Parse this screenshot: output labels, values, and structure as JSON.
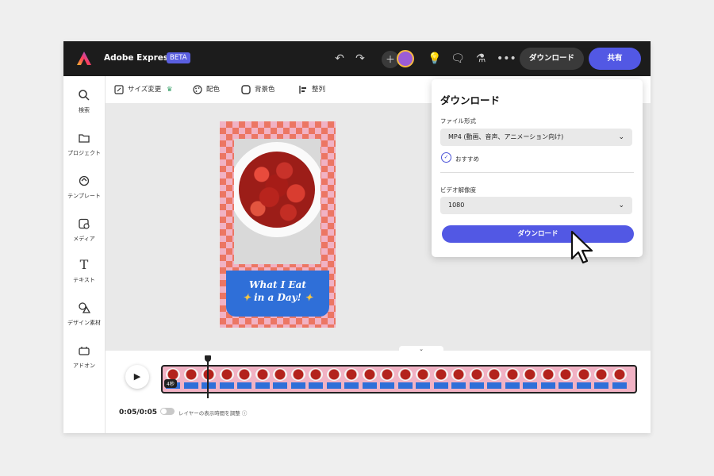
{
  "app": {
    "title": "Adobe Express",
    "beta": "BETA"
  },
  "topbar": {
    "download_label": "ダウンロード",
    "share_label": "共有",
    "icons": [
      "undo-icon",
      "redo-icon",
      "add-user-icon",
      "lightbulb-icon",
      "comment-icon",
      "flask-icon",
      "more-icon"
    ]
  },
  "sidebar": {
    "items": [
      {
        "label": "検索",
        "icon": "search-icon"
      },
      {
        "label": "プロジェクト",
        "icon": "folder-icon"
      },
      {
        "label": "テンプレート",
        "icon": "template-icon"
      },
      {
        "label": "メディア",
        "icon": "media-icon"
      },
      {
        "label": "テキスト",
        "icon": "text-icon"
      },
      {
        "label": "デザイン素材",
        "icon": "shapes-icon"
      },
      {
        "label": "アドオン",
        "icon": "addon-icon"
      }
    ]
  },
  "toolbar": {
    "resize": "サイズ変更",
    "colors": "配色",
    "background": "背景色",
    "align": "整列"
  },
  "design": {
    "line1": "What I Eat",
    "line2": "in a Day!"
  },
  "timeline": {
    "time": "0:05/0:05",
    "toggle_label": "レイヤーの表示時間を調整",
    "clip_badge": "4秒"
  },
  "download_panel": {
    "title": "ダウンロード",
    "format_label": "ファイル形式",
    "format_value": "MP4 (動画、音声、アニメーション向け)",
    "recommended": "おすすめ",
    "resolution_label": "ビデオ解像度",
    "resolution_value": "1080",
    "download_button": "ダウンロード"
  },
  "colors": {
    "accent": "#5258e4",
    "topbar": "#1c1c1c"
  }
}
